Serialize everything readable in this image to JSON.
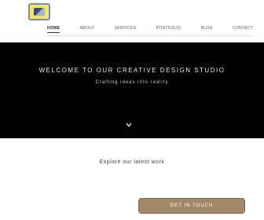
{
  "header": {
    "logo_icon": "logo-icon",
    "nav": [
      {
        "label": "Home",
        "active": true
      },
      {
        "label": "About"
      },
      {
        "label": "Services"
      },
      {
        "label": "Portfolio"
      },
      {
        "label": "Blog"
      },
      {
        "label": "Contact"
      }
    ]
  },
  "hero": {
    "title": "Welcome to our creative design studio",
    "subtitle": "Crafting ideas into reality",
    "scroll_icon": "chevron-down-icon"
  },
  "main": {
    "tagline": "Explore our latest work"
  },
  "cta": {
    "label": "Get in touch"
  },
  "colors": {
    "hero_bg": "#000000",
    "cta_bg": "#a08868",
    "logo_bg": "#f6e36a"
  }
}
